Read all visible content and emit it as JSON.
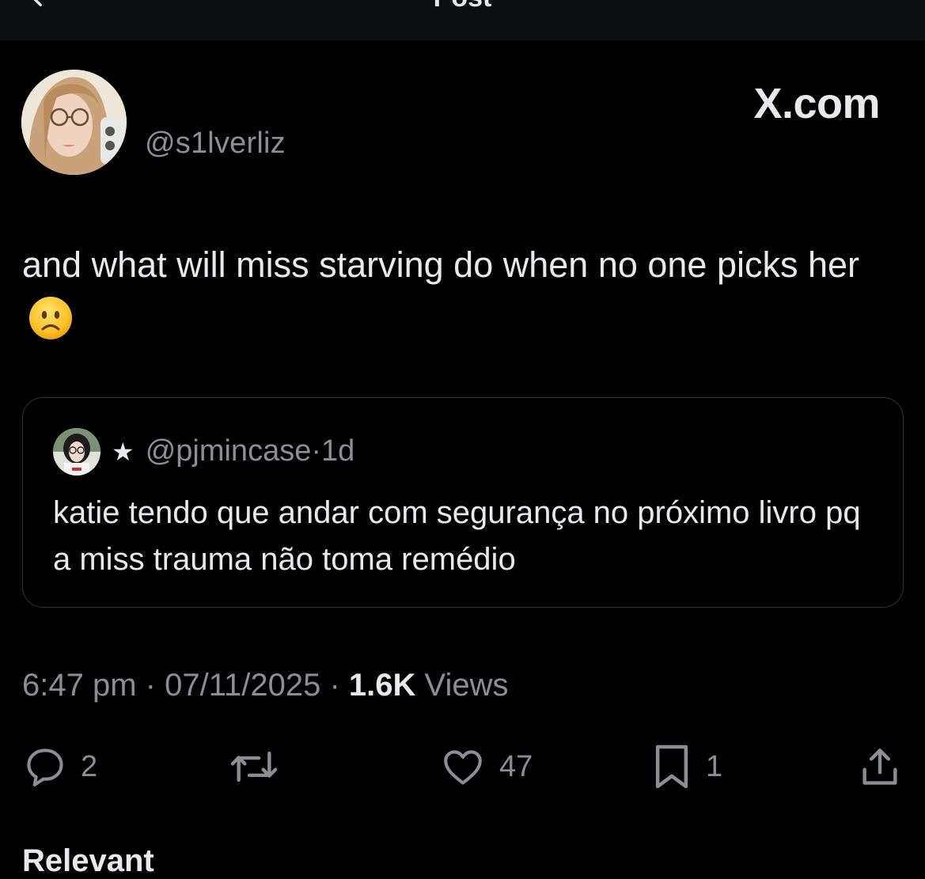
{
  "header": {
    "title": "Post"
  },
  "author": {
    "handle": "@s1lverliz"
  },
  "watermark": "X.com",
  "post": {
    "text": "and what will miss starving do when no one picks her",
    "emoji": "slightly-frowning-face"
  },
  "quoted_post": {
    "handle": "@pjmincase",
    "separator": "·",
    "age": "1d",
    "text": "katie tendo que andar com segurança no próximo livro pq a miss trauma não toma remédio"
  },
  "meta": {
    "time": "6:47 pm",
    "date": "07/11/2025",
    "views_count": "1.6K",
    "views_label": "Views"
  },
  "actions": {
    "reply_count": "2",
    "like_count": "47",
    "bookmark_count": "1"
  },
  "bottom": {
    "section_title": "Relevant"
  },
  "colors": {
    "background": "#000000",
    "text": "#e7e9ea",
    "secondary": "#8b8f94",
    "border": "#2f3336"
  }
}
